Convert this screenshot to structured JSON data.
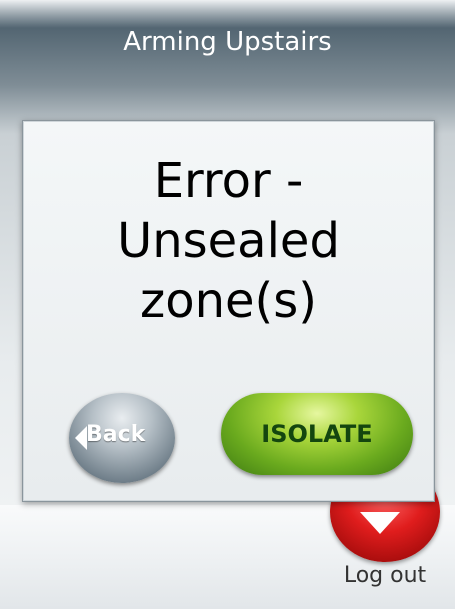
{
  "header": {
    "title": "Arming Upstairs"
  },
  "dialog": {
    "message": "Error -\nUnsealed\nzone(s)",
    "back_label": "Back",
    "isolate_label": "ISOLATE"
  },
  "footer": {
    "logout_label": "Log out"
  },
  "colors": {
    "header_bg": "#3d5260",
    "isolate_green": "#6aaa1e",
    "back_gray": "#71808b",
    "logout_red": "#e01d1d"
  },
  "icons": [
    "back-arrow-icon",
    "logout-down-arrow-icon"
  ]
}
